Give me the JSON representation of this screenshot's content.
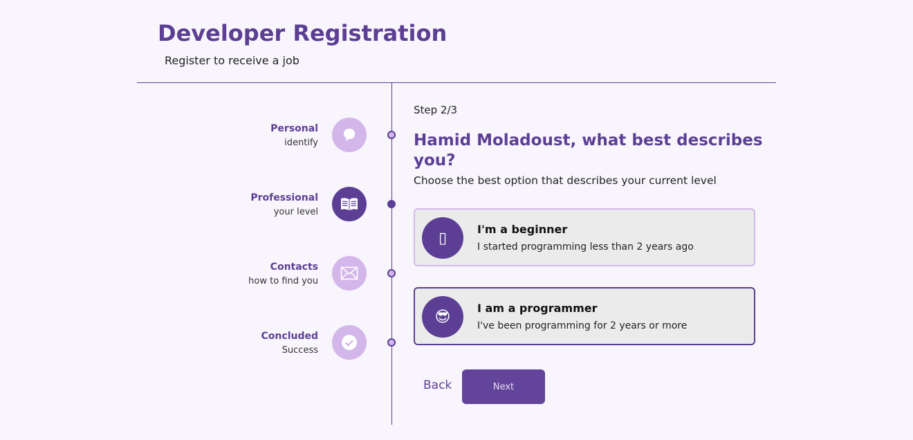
{
  "header": {
    "title": "Developer Registration",
    "subtitle": "Register to receive a job"
  },
  "steps": [
    {
      "label": "Personal",
      "desc": "identify",
      "icon": "chat-bubble-icon",
      "active": false
    },
    {
      "label": "Professional",
      "desc": "your level",
      "icon": "book-icon",
      "active": true
    },
    {
      "label": "Contacts",
      "desc": "how to find you",
      "icon": "envelope-icon",
      "active": false
    },
    {
      "label": "Concluded",
      "desc": "Success",
      "icon": "check-circle-icon",
      "active": false
    }
  ],
  "main": {
    "step_counter": "Step 2/3",
    "question": "Hamid Moladoust, what best describes you?",
    "hint": "Choose the best option that describes your current level",
    "options": [
      {
        "title": "I'm a beginner",
        "desc": "I started programming less than 2 years ago",
        "icon": "beginner-icon",
        "glyph": "▯",
        "selected": false
      },
      {
        "title": "I am a programmer",
        "desc": "I've been programming for 2 years or more",
        "icon": "sunglasses-face-icon",
        "glyph": "😎",
        "selected": true
      }
    ],
    "back_label": "Back",
    "next_label": "Next"
  },
  "colors": {
    "accent": "#5c3f94",
    "accent_light": "#d3b6ea",
    "background": "#f8f5fc",
    "card": "#ebebeb"
  }
}
